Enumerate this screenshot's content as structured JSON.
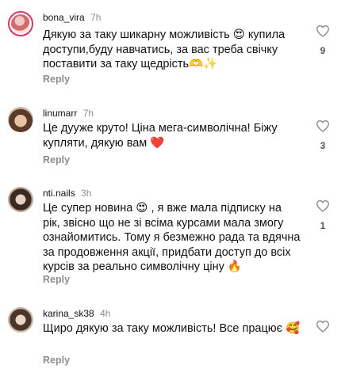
{
  "comments": [
    {
      "username": "bona_vira",
      "time": "7h",
      "text": "Дякую за таку шикарну можливість 😍 купила доступи,буду навчатись, за вас треба свічку поставити за таку щедрість🫶✨",
      "reply_label": "Reply",
      "likes": "9"
    },
    {
      "username": "linumarr",
      "time": "7h",
      "text": "Це дууже круто! Ціна мега-символічна! Біжу купляти, дякую вам ❤️",
      "reply_label": "Reply",
      "likes": "3"
    },
    {
      "username": "nti.nails",
      "time": "3h",
      "text": "Це супер новина 😍 , я вже мала підписку на рік, звісно що не зі всіма курсами мала змогу ознайомитись. Тому я безмежно рада та вдячна за продовження акції, придбати доступ до всіх курсів за реально символічну ціну 🔥",
      "reply_label": "Reply",
      "likes": "1"
    },
    {
      "username": "karina_sk38",
      "time": "4h",
      "text": "Щиро дякую за таку можливість! Все працює 🥰",
      "reply_label": "Reply",
      "likes": ""
    }
  ],
  "colors": {
    "muted": "#8e8e8e",
    "story_ring": "#e1306c"
  },
  "icons": {
    "like": "heart-outline-icon"
  }
}
